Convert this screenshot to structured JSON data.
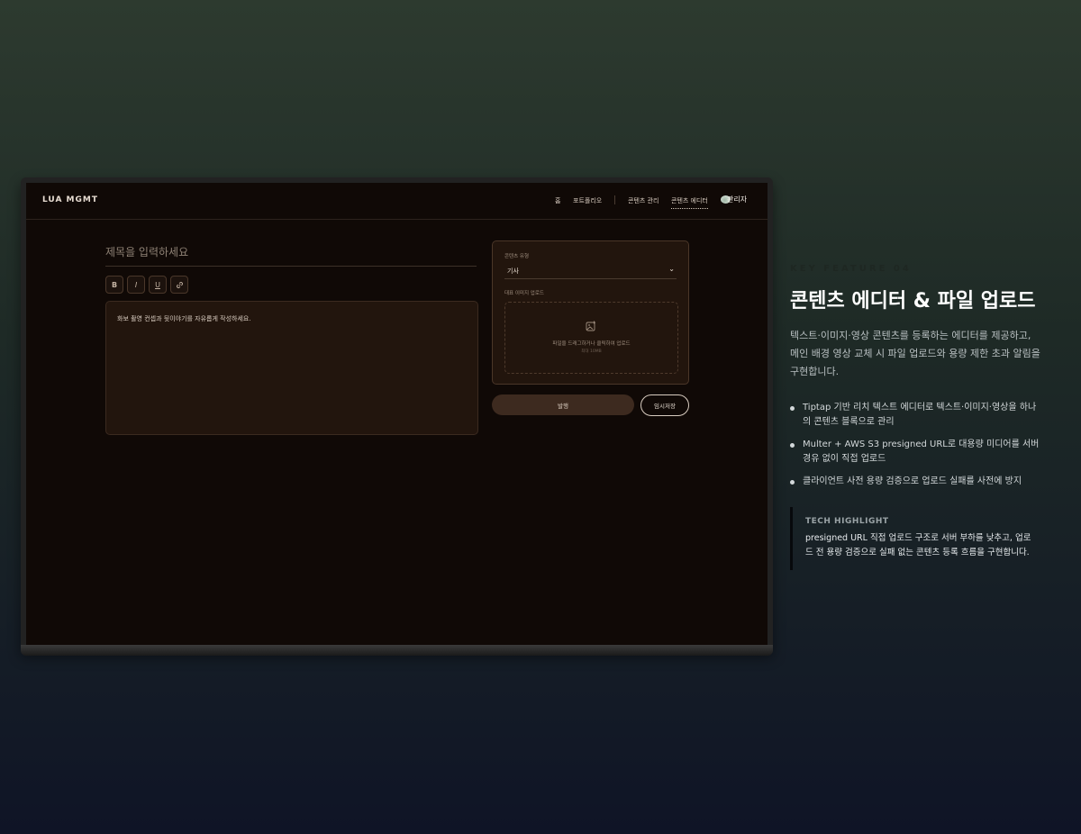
{
  "app": {
    "brand": "LUA MGMT",
    "nav": [
      {
        "label": "홈"
      },
      {
        "label": "포트폴리오"
      },
      {
        "label": "콘텐츠 관리"
      },
      {
        "label": "콘텐츠 에디터",
        "active": true
      }
    ],
    "user_label": "관리자",
    "editor": {
      "title_placeholder": "제목을 입력하세요",
      "toolbar": [
        "B",
        "I",
        "U",
        "link-icon"
      ],
      "body_placeholder": "화보 촬영 컨셉과 뒷이야기를 자유롭게 작성하세요."
    },
    "side": {
      "type_label": "콘텐츠 유형",
      "type_value": "기사",
      "upload_label": "대표 이미지 업로드",
      "drop_text": "파일을 드래그하거나 클릭하여 업로드",
      "drop_sub": "최대 10MB",
      "publish_label": "발행",
      "draft_label": "임시저장"
    }
  },
  "feature": {
    "kicker": "KEY FEATURE 04",
    "title": "콘텐츠 에디터 & 파일 업로드",
    "description": "텍스트·이미지·영상 콘텐츠를 등록하는 에디터를 제공하고, 메인 배경 영상 교체 시 파일 업로드와 용량 제한 초과 알림을 구현합니다.",
    "bullets": [
      "Tiptap 기반 리치 텍스트 에디터로 텍스트·이미지·영상을 하나의 콘텐츠 블록으로 관리",
      "Multer + AWS S3 presigned URL로 대용량 미디어를 서버 경유 없이 직접 업로드",
      "클라이언트 사전 용량 검증으로 업로드 실패를 사전에 방지"
    ],
    "highlight_title": "TECH HIGHLIGHT",
    "highlight_text": "presigned URL 직접 업로드 구조로 서버 부하를 낮추고, 업로드 전 용량 검증으로 실패 없는 콘텐츠 등록 흐름을 구현합니다."
  },
  "colors": {
    "screen_bg": "#100906",
    "panel_bg": "#22150d",
    "accent_button": "#3d2a1f"
  }
}
